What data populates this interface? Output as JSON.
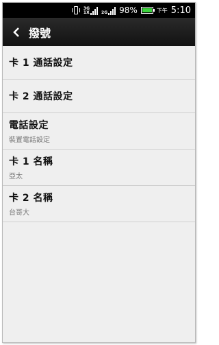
{
  "status_bar": {
    "network_top": "3G",
    "network_bottom": "1X",
    "network2": "2G",
    "battery_percent": "98%",
    "ampm": "下午",
    "time": "5:10",
    "battery_color": "#3dd23d"
  },
  "action_bar": {
    "title": "撥號",
    "back_icon": "chevron-left-icon"
  },
  "list": {
    "items": [
      {
        "label": "卡 1 通話設定"
      },
      {
        "label": "卡 2 通話設定"
      },
      {
        "label": "電話設定",
        "sub": "裝置電話設定"
      },
      {
        "label": "卡 1 名稱",
        "sub": "亞太"
      },
      {
        "label": "卡 2 名稱",
        "sub": "台哥大"
      }
    ]
  }
}
